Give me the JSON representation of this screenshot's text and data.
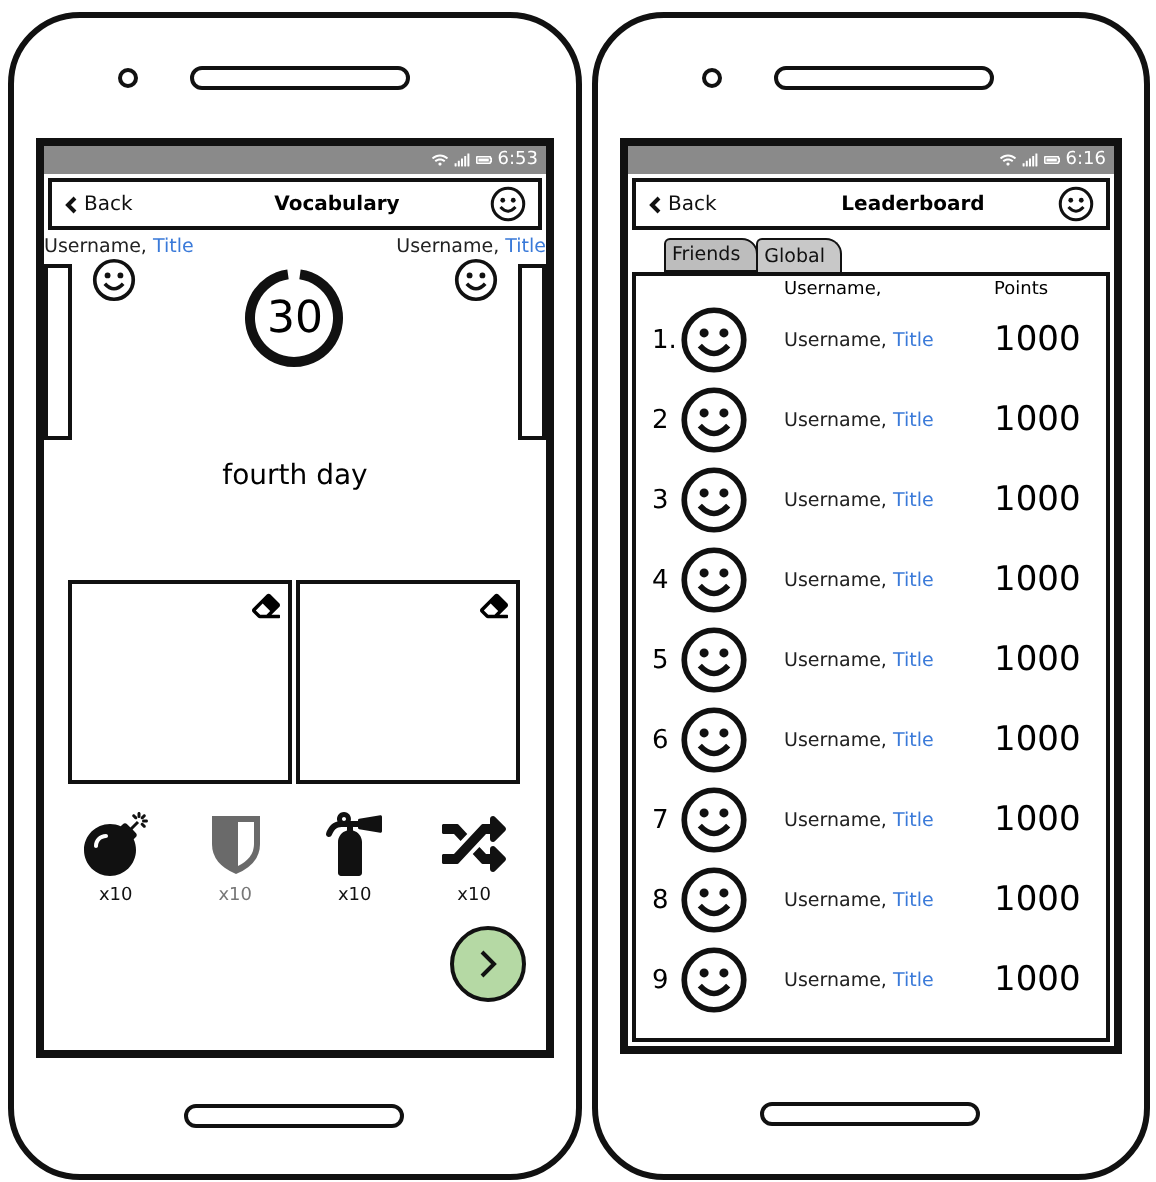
{
  "vocabulary_screen": {
    "status_time": "6:53",
    "header": {
      "back": "Back",
      "title": "Vocabulary"
    },
    "players": [
      {
        "username": "Username,",
        "title": "Title"
      },
      {
        "username": "Username,",
        "title": "Title"
      }
    ],
    "timer": "30",
    "day": "fourth day",
    "powerups": [
      {
        "kind": "bomb",
        "count": "x10",
        "disabled": false
      },
      {
        "kind": "shield",
        "count": "x10",
        "disabled": true
      },
      {
        "kind": "extinguisher",
        "count": "x10",
        "disabled": false
      },
      {
        "kind": "shuffle",
        "count": "x10",
        "disabled": false
      }
    ]
  },
  "leaderboard_screen": {
    "status_time": "6:16",
    "header": {
      "back": "Back",
      "title": "Leaderboard"
    },
    "tabs": [
      {
        "label": "Friends",
        "selected": false
      },
      {
        "label": "Global",
        "selected": true
      }
    ],
    "columns": [
      "Username,",
      "Points"
    ],
    "rows": [
      {
        "rank": "1.",
        "username": "Username,",
        "title": "Title",
        "points": "1000"
      },
      {
        "rank": "2",
        "username": "Username,",
        "title": "Title",
        "points": "1000"
      },
      {
        "rank": "3",
        "username": "Username,",
        "title": "Title",
        "points": "1000"
      },
      {
        "rank": "4",
        "username": "Username,",
        "title": "Title",
        "points": "1000"
      },
      {
        "rank": "5",
        "username": "Username,",
        "title": "Title",
        "points": "1000"
      },
      {
        "rank": "6",
        "username": "Username,",
        "title": "Title",
        "points": "1000"
      },
      {
        "rank": "7",
        "username": "Username,",
        "title": "Title",
        "points": "1000"
      },
      {
        "rank": "8",
        "username": "Username,",
        "title": "Title",
        "points": "1000"
      },
      {
        "rank": "9",
        "username": "Username,",
        "title": "Title",
        "points": "1000"
      }
    ]
  }
}
